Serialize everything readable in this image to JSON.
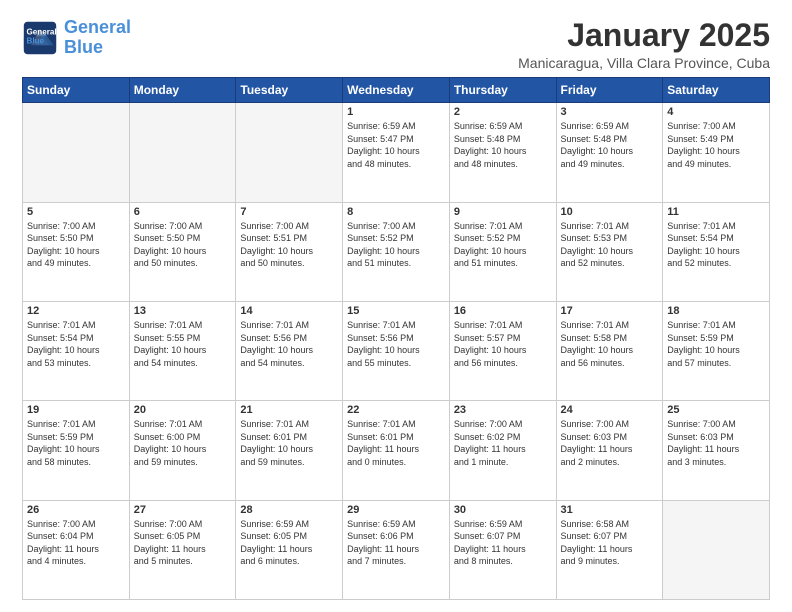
{
  "header": {
    "logo_line1": "General",
    "logo_line2": "Blue",
    "month": "January 2025",
    "location": "Manicaragua, Villa Clara Province, Cuba"
  },
  "days_of_week": [
    "Sunday",
    "Monday",
    "Tuesday",
    "Wednesday",
    "Thursday",
    "Friday",
    "Saturday"
  ],
  "weeks": [
    [
      {
        "day": "",
        "info": ""
      },
      {
        "day": "",
        "info": ""
      },
      {
        "day": "",
        "info": ""
      },
      {
        "day": "1",
        "info": "Sunrise: 6:59 AM\nSunset: 5:47 PM\nDaylight: 10 hours\nand 48 minutes."
      },
      {
        "day": "2",
        "info": "Sunrise: 6:59 AM\nSunset: 5:48 PM\nDaylight: 10 hours\nand 48 minutes."
      },
      {
        "day": "3",
        "info": "Sunrise: 6:59 AM\nSunset: 5:48 PM\nDaylight: 10 hours\nand 49 minutes."
      },
      {
        "day": "4",
        "info": "Sunrise: 7:00 AM\nSunset: 5:49 PM\nDaylight: 10 hours\nand 49 minutes."
      }
    ],
    [
      {
        "day": "5",
        "info": "Sunrise: 7:00 AM\nSunset: 5:50 PM\nDaylight: 10 hours\nand 49 minutes."
      },
      {
        "day": "6",
        "info": "Sunrise: 7:00 AM\nSunset: 5:50 PM\nDaylight: 10 hours\nand 50 minutes."
      },
      {
        "day": "7",
        "info": "Sunrise: 7:00 AM\nSunset: 5:51 PM\nDaylight: 10 hours\nand 50 minutes."
      },
      {
        "day": "8",
        "info": "Sunrise: 7:00 AM\nSunset: 5:52 PM\nDaylight: 10 hours\nand 51 minutes."
      },
      {
        "day": "9",
        "info": "Sunrise: 7:01 AM\nSunset: 5:52 PM\nDaylight: 10 hours\nand 51 minutes."
      },
      {
        "day": "10",
        "info": "Sunrise: 7:01 AM\nSunset: 5:53 PM\nDaylight: 10 hours\nand 52 minutes."
      },
      {
        "day": "11",
        "info": "Sunrise: 7:01 AM\nSunset: 5:54 PM\nDaylight: 10 hours\nand 52 minutes."
      }
    ],
    [
      {
        "day": "12",
        "info": "Sunrise: 7:01 AM\nSunset: 5:54 PM\nDaylight: 10 hours\nand 53 minutes."
      },
      {
        "day": "13",
        "info": "Sunrise: 7:01 AM\nSunset: 5:55 PM\nDaylight: 10 hours\nand 54 minutes."
      },
      {
        "day": "14",
        "info": "Sunrise: 7:01 AM\nSunset: 5:56 PM\nDaylight: 10 hours\nand 54 minutes."
      },
      {
        "day": "15",
        "info": "Sunrise: 7:01 AM\nSunset: 5:56 PM\nDaylight: 10 hours\nand 55 minutes."
      },
      {
        "day": "16",
        "info": "Sunrise: 7:01 AM\nSunset: 5:57 PM\nDaylight: 10 hours\nand 56 minutes."
      },
      {
        "day": "17",
        "info": "Sunrise: 7:01 AM\nSunset: 5:58 PM\nDaylight: 10 hours\nand 56 minutes."
      },
      {
        "day": "18",
        "info": "Sunrise: 7:01 AM\nSunset: 5:59 PM\nDaylight: 10 hours\nand 57 minutes."
      }
    ],
    [
      {
        "day": "19",
        "info": "Sunrise: 7:01 AM\nSunset: 5:59 PM\nDaylight: 10 hours\nand 58 minutes."
      },
      {
        "day": "20",
        "info": "Sunrise: 7:01 AM\nSunset: 6:00 PM\nDaylight: 10 hours\nand 59 minutes."
      },
      {
        "day": "21",
        "info": "Sunrise: 7:01 AM\nSunset: 6:01 PM\nDaylight: 10 hours\nand 59 minutes."
      },
      {
        "day": "22",
        "info": "Sunrise: 7:01 AM\nSunset: 6:01 PM\nDaylight: 11 hours\nand 0 minutes."
      },
      {
        "day": "23",
        "info": "Sunrise: 7:00 AM\nSunset: 6:02 PM\nDaylight: 11 hours\nand 1 minute."
      },
      {
        "day": "24",
        "info": "Sunrise: 7:00 AM\nSunset: 6:03 PM\nDaylight: 11 hours\nand 2 minutes."
      },
      {
        "day": "25",
        "info": "Sunrise: 7:00 AM\nSunset: 6:03 PM\nDaylight: 11 hours\nand 3 minutes."
      }
    ],
    [
      {
        "day": "26",
        "info": "Sunrise: 7:00 AM\nSunset: 6:04 PM\nDaylight: 11 hours\nand 4 minutes."
      },
      {
        "day": "27",
        "info": "Sunrise: 7:00 AM\nSunset: 6:05 PM\nDaylight: 11 hours\nand 5 minutes."
      },
      {
        "day": "28",
        "info": "Sunrise: 6:59 AM\nSunset: 6:05 PM\nDaylight: 11 hours\nand 6 minutes."
      },
      {
        "day": "29",
        "info": "Sunrise: 6:59 AM\nSunset: 6:06 PM\nDaylight: 11 hours\nand 7 minutes."
      },
      {
        "day": "30",
        "info": "Sunrise: 6:59 AM\nSunset: 6:07 PM\nDaylight: 11 hours\nand 8 minutes."
      },
      {
        "day": "31",
        "info": "Sunrise: 6:58 AM\nSunset: 6:07 PM\nDaylight: 11 hours\nand 9 minutes."
      },
      {
        "day": "",
        "info": ""
      }
    ]
  ]
}
